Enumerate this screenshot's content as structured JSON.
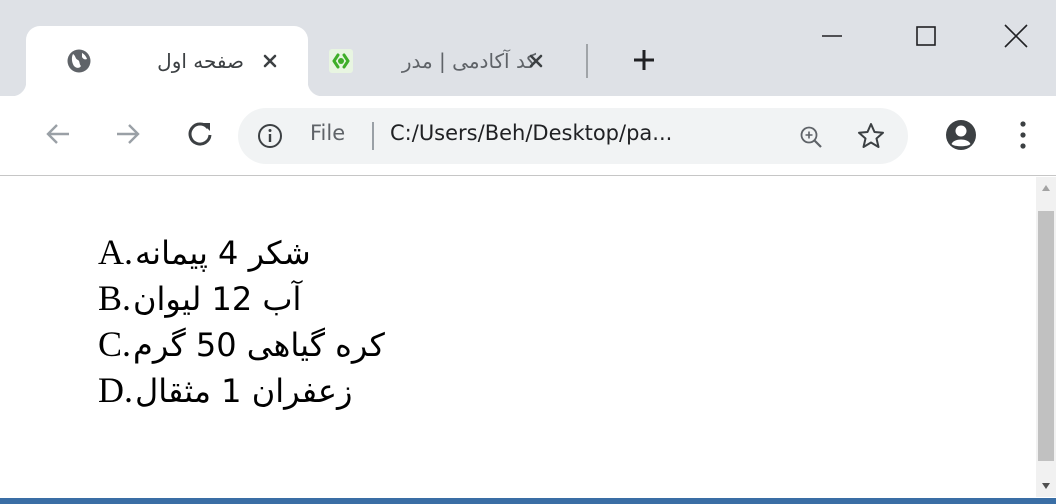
{
  "tabs": [
    {
      "title": "صفحه اول",
      "active": true,
      "icon": "globe-icon"
    },
    {
      "title": "کد آکادمی | مدر",
      "active": false,
      "icon": "codeacademy-favicon-icon"
    }
  ],
  "toolbar": {
    "scheme_label": "File",
    "url": "C:/Users/Beh/Desktop/pa..."
  },
  "ingredients": [
    {
      "marker": "A.",
      "text": "شکر 4 پیمانه"
    },
    {
      "marker": "B.",
      "text": "آب 12 لیوان"
    },
    {
      "marker": "C.",
      "text": "کره گیاهی 50 گرم"
    },
    {
      "marker": "D.",
      "text": "زعفران 1 مثقال"
    }
  ],
  "colors": {
    "tabstrip": "#dee1e6",
    "omnibox": "#f1f3f4",
    "favicon_green": "#3fae29",
    "taskbar": "#3a6ea5"
  }
}
